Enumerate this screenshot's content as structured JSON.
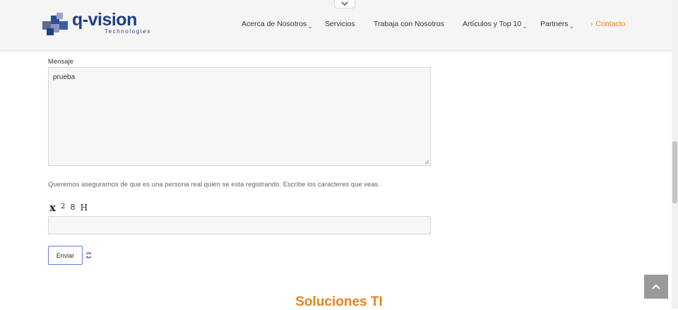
{
  "header": {
    "logo": {
      "wordmark": "q-vision",
      "tagline": "Technologies",
      "brand_color": "#1e3f8a"
    },
    "collapse_icon": "chevron-down-icon",
    "nav": [
      {
        "label": "Acerca de Nosotros",
        "has_dropdown": true
      },
      {
        "label": "Servicios",
        "has_dropdown": false
      },
      {
        "label": "Trabaja con Nosotros",
        "has_dropdown": false
      },
      {
        "label": "Artículos y Top 10",
        "has_dropdown": true
      },
      {
        "label": "Partners",
        "has_dropdown": true
      },
      {
        "label": "Contacto",
        "has_dropdown": false,
        "active": true,
        "icon": "chevron-right-icon"
      }
    ]
  },
  "form": {
    "message_label": "Mensaje",
    "message_value": "prueba",
    "captcha_note": "Queremos asegurarnos de que es una persona real quien se está registrando. Escribe los caracteres que veas.",
    "captcha_chars": [
      "x",
      "2",
      "8",
      "H"
    ],
    "captcha_value": "",
    "submit_label": "Enviar",
    "refresh_icon": "refresh-icon"
  },
  "section": {
    "title": "Soluciones TI"
  },
  "colors": {
    "accent": "#e8821d",
    "button_border": "#5b7fd4"
  },
  "back_to_top_icon": "chevron-up-icon"
}
